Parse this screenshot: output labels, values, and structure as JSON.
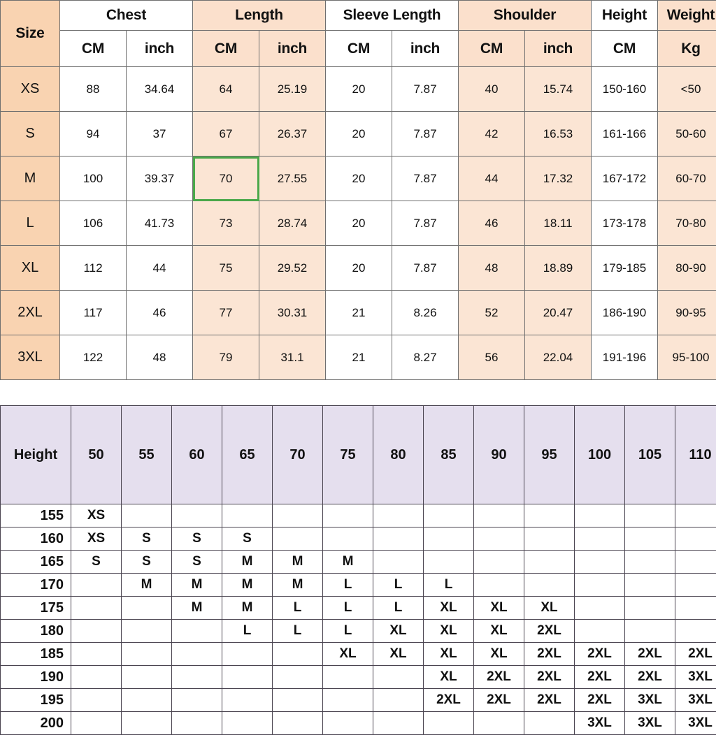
{
  "size_chart": {
    "row_header_label": "Size",
    "groups": [
      {
        "label": "Chest",
        "units": [
          "CM",
          "inch"
        ],
        "shaded": false
      },
      {
        "label": "Length",
        "units": [
          "CM",
          "inch"
        ],
        "shaded": true
      },
      {
        "label": "Sleeve Length",
        "units": [
          "CM",
          "inch"
        ],
        "shaded": false
      },
      {
        "label": "Shoulder",
        "units": [
          "CM",
          "inch"
        ],
        "shaded": true
      },
      {
        "label": "Height",
        "units": [
          "CM"
        ],
        "shaded": false
      },
      {
        "label": "Weight",
        "units": [
          "Kg"
        ],
        "shaded": true
      }
    ],
    "rows": [
      {
        "size": "XS",
        "chest_cm": "88",
        "chest_in": "34.64",
        "length_cm": "64",
        "length_in": "25.19",
        "sleeve_cm": "20",
        "sleeve_in": "7.87",
        "shoulder_cm": "40",
        "shoulder_in": "15.74",
        "height_cm": "150-160",
        "weight_kg": "<50"
      },
      {
        "size": "S",
        "chest_cm": "94",
        "chest_in": "37",
        "length_cm": "67",
        "length_in": "26.37",
        "sleeve_cm": "20",
        "sleeve_in": "7.87",
        "shoulder_cm": "42",
        "shoulder_in": "16.53",
        "height_cm": "161-166",
        "weight_kg": "50-60"
      },
      {
        "size": "M",
        "chest_cm": "100",
        "chest_in": "39.37",
        "length_cm": "70",
        "length_in": "27.55",
        "sleeve_cm": "20",
        "sleeve_in": "7.87",
        "shoulder_cm": "44",
        "shoulder_in": "17.32",
        "height_cm": "167-172",
        "weight_kg": "60-70"
      },
      {
        "size": "L",
        "chest_cm": "106",
        "chest_in": "41.73",
        "length_cm": "73",
        "length_in": "28.74",
        "sleeve_cm": "20",
        "sleeve_in": "7.87",
        "shoulder_cm": "46",
        "shoulder_in": "18.11",
        "height_cm": "173-178",
        "weight_kg": "70-80"
      },
      {
        "size": "XL",
        "chest_cm": "112",
        "chest_in": "44",
        "length_cm": "75",
        "length_in": "29.52",
        "sleeve_cm": "20",
        "sleeve_in": "7.87",
        "shoulder_cm": "48",
        "shoulder_in": "18.89",
        "height_cm": "179-185",
        "weight_kg": "80-90"
      },
      {
        "size": "2XL",
        "chest_cm": "117",
        "chest_in": "46",
        "length_cm": "77",
        "length_in": "30.31",
        "sleeve_cm": "21",
        "sleeve_in": "8.26",
        "shoulder_cm": "52",
        "shoulder_in": "20.47",
        "height_cm": "186-190",
        "weight_kg": "90-95"
      },
      {
        "size": "3XL",
        "chest_cm": "122",
        "chest_in": "48",
        "length_cm": "79",
        "length_in": "31.1",
        "sleeve_cm": "21",
        "sleeve_in": "8.27",
        "shoulder_cm": "56",
        "shoulder_in": "22.04",
        "height_cm": "191-196",
        "weight_kg": "95-100"
      }
    ],
    "highlighted_cell": {
      "row": "M",
      "column": "length_cm",
      "value": "70",
      "outline_color": "#4aa84a"
    },
    "colors": {
      "size_column": "#f9d3b1",
      "group_header_shaded": "#fbe0cc",
      "cell_shaded": "#fbe5d4",
      "cell_plain": "#ffffff",
      "border": "#6f6f6f"
    }
  },
  "fit_matrix": {
    "corner_label": "Height",
    "weight_columns": [
      "50",
      "55",
      "60",
      "65",
      "70",
      "75",
      "80",
      "85",
      "90",
      "95",
      "100",
      "105",
      "110"
    ],
    "height_rows": [
      "155",
      "160",
      "165",
      "170",
      "175",
      "180",
      "185",
      "190",
      "195",
      "200"
    ],
    "cells": [
      [
        "XS",
        "",
        "",
        "",
        "",
        "",
        "",
        "",
        "",
        "",
        "",
        "",
        ""
      ],
      [
        "XS",
        "S",
        "S",
        "S",
        "",
        "",
        "",
        "",
        "",
        "",
        "",
        "",
        ""
      ],
      [
        "S",
        "S",
        "S",
        "M",
        "M",
        "M",
        "",
        "",
        "",
        "",
        "",
        "",
        ""
      ],
      [
        "",
        "M",
        "M",
        "M",
        "M",
        "L",
        "L",
        "L",
        "",
        "",
        "",
        "",
        ""
      ],
      [
        "",
        "",
        "M",
        "M",
        "L",
        "L",
        "L",
        "XL",
        "XL",
        "XL",
        "",
        "",
        ""
      ],
      [
        "",
        "",
        "",
        "L",
        "L",
        "L",
        "XL",
        "XL",
        "XL",
        "2XL",
        "",
        "",
        ""
      ],
      [
        "",
        "",
        "",
        "",
        "",
        "XL",
        "XL",
        "XL",
        "XL",
        "2XL",
        "2XL",
        "2XL",
        "2XL"
      ],
      [
        "",
        "",
        "",
        "",
        "",
        "",
        "",
        "XL",
        "2XL",
        "2XL",
        "2XL",
        "2XL",
        "3XL"
      ],
      [
        "",
        "",
        "",
        "",
        "",
        "",
        "",
        "2XL",
        "2XL",
        "2XL",
        "2XL",
        "3XL",
        "3XL"
      ],
      [
        "",
        "",
        "",
        "",
        "",
        "",
        "",
        "",
        "",
        "",
        "3XL",
        "3XL",
        "3XL"
      ]
    ],
    "colors": {
      "header": "#e5dfee",
      "XS": "#d4d4d4",
      "S": "#eeecdf",
      "M": "#d9d3bb",
      "L": "#c3d7ee",
      "XL": "#f3d9da",
      "2XL": "#e2aeae",
      "3XL": "#bfdfe8",
      "border": "#4a4450"
    }
  }
}
